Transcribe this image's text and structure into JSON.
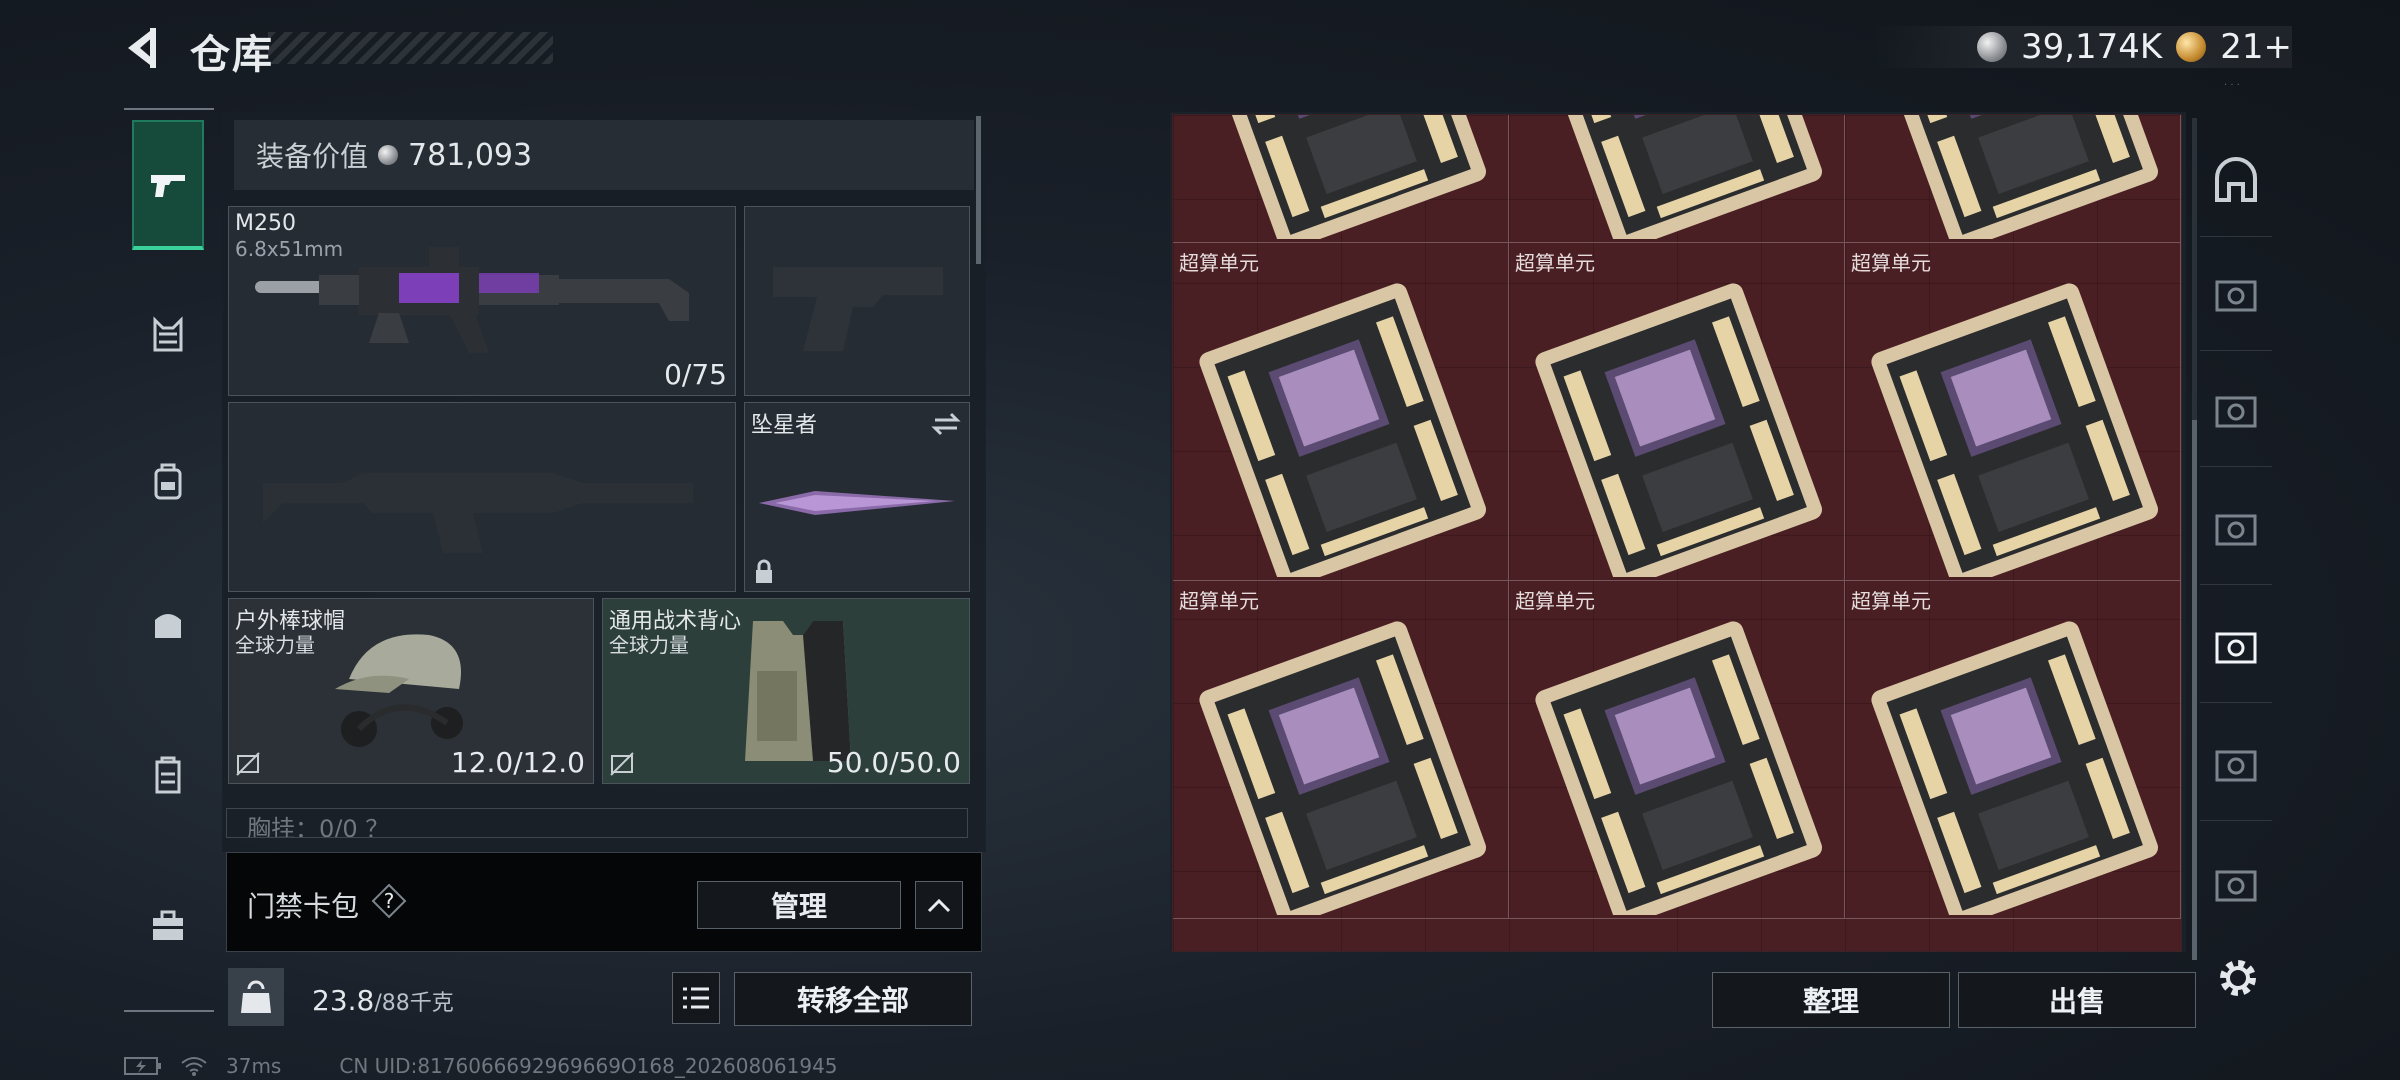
{
  "header": {
    "title": "仓库",
    "silver_amount": "39,174K",
    "gold_amount": "21+"
  },
  "loadout": {
    "equip_value_label": "装备价值",
    "equip_value": "781,093",
    "primary": {
      "name": "M250",
      "caliber": "6.8x51mm",
      "ammo": "0/75"
    },
    "melee": {
      "name": "坠星者"
    },
    "helmet": {
      "name": "户外棒球帽",
      "brand": "全球力量",
      "durability": "12.0/12.0"
    },
    "vest": {
      "name": "通用战术背心",
      "brand": "全球力量",
      "durability": "50.0/50.0"
    },
    "chest_rig_partial": "胸挂：0/0 ？"
  },
  "card_bar": {
    "label": "门禁卡包",
    "help": "?",
    "manage": "管理"
  },
  "bottom": {
    "weight": "23.8",
    "capacity": "/88千克",
    "transfer_all": "转移全部"
  },
  "status": {
    "latency": "37ms",
    "uid": "CN UID:8176066692969669O168_202608061945"
  },
  "stash": {
    "item_name": "超算单元",
    "rows": [
      {
        "labels": [
          "",
          "",
          ""
        ]
      },
      {
        "labels": [
          "超算单元",
          "超算单元",
          "超算单元"
        ]
      },
      {
        "labels": [
          "超算单元",
          "超算单元",
          "超算单元"
        ]
      }
    ],
    "sort": "整理",
    "sell": "出售"
  },
  "colors": {
    "stash_bg": "#4a1f24",
    "active_tab": "#3ad29a",
    "vest_slot": "#2d3f3a"
  }
}
